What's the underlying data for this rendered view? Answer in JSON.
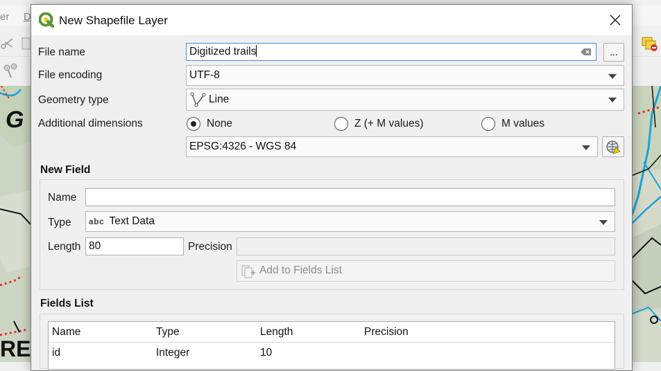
{
  "background": {
    "menu_partial_1": "er",
    "menu_partial_2": "D",
    "map_text_1": "G",
    "map_text_2": "RES",
    "map_text_3": "\\"
  },
  "dialog": {
    "title": "New Shapefile Layer",
    "icon": "qgis-logo-icon",
    "close_icon": "close-icon"
  },
  "form": {
    "file_name_label": "File name",
    "file_name_value": "Digitized trails",
    "browse_label": "...",
    "file_encoding_label": "File encoding",
    "file_encoding_value": "UTF-8",
    "geometry_type_label": "Geometry type",
    "geometry_type_value": "Line",
    "additional_dimensions_label": "Additional dimensions",
    "dimension_options": [
      "None",
      "Z (+ M values)",
      "M values"
    ],
    "dimension_selected": "None",
    "crs_value": "EPSG:4326 - WGS 84"
  },
  "new_field": {
    "title": "New Field",
    "name_label": "Name",
    "name_value": "",
    "type_label": "Type",
    "type_icon_text": "abc",
    "type_value": "Text Data",
    "length_label": "Length",
    "length_value": "80",
    "precision_label": "Precision",
    "precision_value": "",
    "add_button_label": "Add to Fields List"
  },
  "fields_list": {
    "title": "Fields List",
    "columns": [
      "Name",
      "Type",
      "Length",
      "Precision"
    ],
    "rows": [
      [
        "id",
        "Integer",
        "10",
        ""
      ]
    ]
  },
  "colors": {
    "accent_focus": "#3c8dde",
    "qgis_green": "#589632",
    "qgis_yellow": "#eec90d",
    "map_trail_blue": "#1aa3d9",
    "map_trail_red": "#e0322b"
  }
}
